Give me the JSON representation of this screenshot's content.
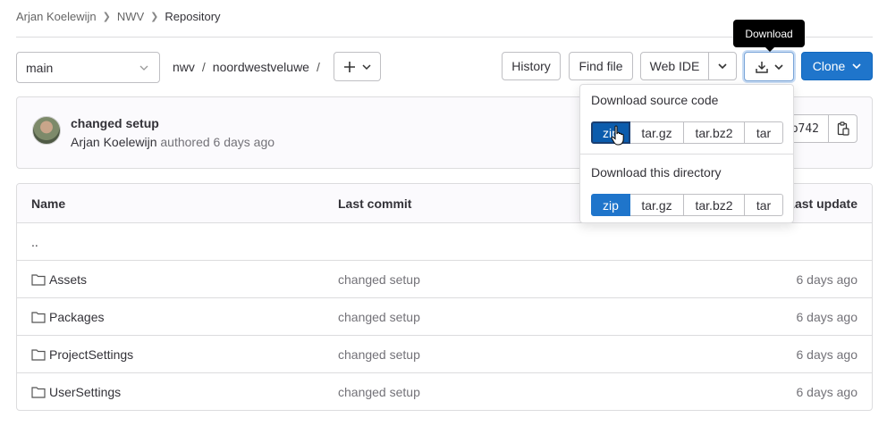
{
  "breadcrumb": {
    "items": [
      "Arjan Koelewijn",
      "NWV"
    ],
    "current": "Repository"
  },
  "toolbar": {
    "branch": "main",
    "path": [
      "nwv",
      "noordwestveluwe"
    ],
    "path_sep": "/",
    "history_label": "History",
    "find_file_label": "Find file",
    "web_ide_label": "Web IDE",
    "download_tooltip": "Download",
    "clone_label": "Clone"
  },
  "commit": {
    "title": "changed setup",
    "author": "Arjan Koelewijn",
    "meta": "authored 6 days ago",
    "sha": "b742"
  },
  "download_menu": {
    "source_heading": "Download source code",
    "directory_heading": "Download this directory",
    "formats": [
      "zip",
      "tar.gz",
      "tar.bz2",
      "tar"
    ]
  },
  "table": {
    "headers": {
      "name": "Name",
      "last_commit": "Last commit",
      "last_update": "Last update"
    },
    "parent": "..",
    "rows": [
      {
        "name": "Assets",
        "commit": "changed setup",
        "updated": "6 days ago"
      },
      {
        "name": "Packages",
        "commit": "changed setup",
        "updated": "6 days ago"
      },
      {
        "name": "ProjectSettings",
        "commit": "changed setup",
        "updated": "6 days ago"
      },
      {
        "name": "UserSettings",
        "commit": "changed setup",
        "updated": "6 days ago"
      }
    ]
  },
  "colors": {
    "primary": "#1f75cb",
    "pressed": "#0b5cad",
    "border": "#dcdcde"
  },
  "icons": [
    "chevron-right-icon",
    "chevron-down-icon",
    "plus-icon",
    "download-icon",
    "copy-icon",
    "folder-icon",
    "hand-cursor-icon"
  ]
}
